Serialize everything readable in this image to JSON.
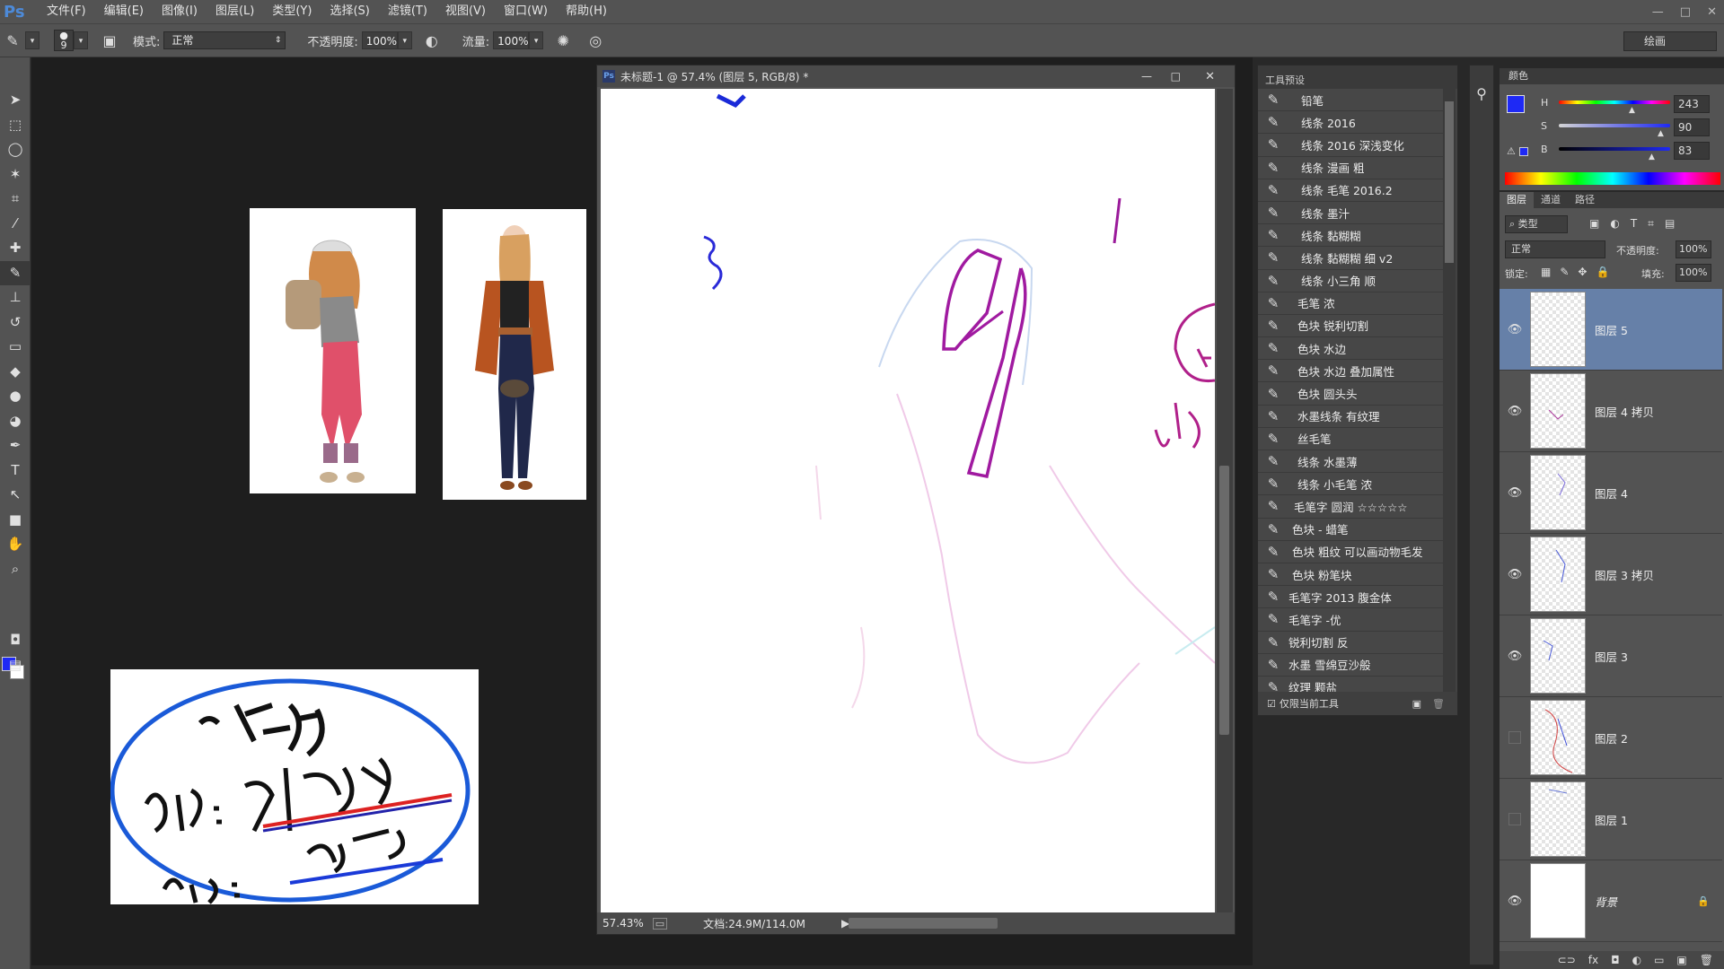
{
  "app": {
    "logo": "Ps"
  },
  "menu": [
    "文件(F)",
    "编辑(E)",
    "图像(I)",
    "图层(L)",
    "类型(Y)",
    "选择(S)",
    "滤镜(T)",
    "视图(V)",
    "窗口(W)",
    "帮助(H)"
  ],
  "window_controls": {
    "minimize": "—",
    "maximize": "□",
    "close": "✕"
  },
  "options": {
    "brush_size": "9",
    "mode_label": "模式:",
    "mode_value": "正常",
    "opacity_label": "不透明度:",
    "opacity_value": "100%",
    "flow_label": "流量:",
    "flow_value": "100%",
    "workspace": "绘画"
  },
  "document": {
    "title": "未标题-1 @ 57.4% (图层 5, RGB/8) *",
    "zoom": "57.43%",
    "doc_size": "文档:24.9M/114.0M"
  },
  "presets": {
    "tab": "工具预设",
    "items": [
      "铅笔",
      "线条 2016",
      "线条 2016 深浅变化",
      "线条 漫画 粗",
      "线条 毛笔 2016.2",
      "线条 墨汁",
      "线条 黏糊糊",
      "线条 黏糊糊 细 v2",
      "线条 小三角 顺",
      "毛笔 浓",
      "色块 锐利切割",
      "色块 水边",
      "色块 水边 叠加属性",
      "色块 圆头头",
      "水墨线条 有纹理",
      "丝毛笔",
      "线条 水墨薄",
      "线条 小毛笔 浓",
      "毛笔字 圆润 ☆☆☆☆☆",
      "色块 - 蜡笔",
      "色块 粗纹 可以画动物毛发",
      "色块 粉笔块",
      "毛笔字 2013 腹金体",
      "毛笔字 -优",
      "锐利切割 反",
      "水墨 雪绵豆沙般",
      "纹理 颗盐"
    ],
    "footer": "仅限当前工具"
  },
  "color_panel": {
    "tab": "颜色",
    "h_label": "H",
    "h_value": "243",
    "s_label": "S",
    "s_value": "90",
    "b_label": "B",
    "b_value": "83",
    "foreground": "#1e29f5",
    "background": "#ffffff"
  },
  "layers_panel": {
    "tabs": [
      "图层",
      "通道",
      "路径"
    ],
    "filter": "类型",
    "blend_mode": "正常",
    "opacity_label": "不透明度:",
    "opacity_value": "100%",
    "lock_label": "锁定:",
    "fill_label": "填充:",
    "fill_value": "100%",
    "layers": [
      {
        "name": "图层 5",
        "visible": true,
        "selected": true
      },
      {
        "name": "图层 4 拷贝",
        "visible": true,
        "selected": false
      },
      {
        "name": "图层 4",
        "visible": true,
        "selected": false
      },
      {
        "name": "图层 3 拷贝",
        "visible": true,
        "selected": false
      },
      {
        "name": "图层 3",
        "visible": true,
        "selected": false
      },
      {
        "name": "图层 2",
        "visible": false,
        "selected": false
      },
      {
        "name": "图层 1",
        "visible": false,
        "selected": false
      },
      {
        "name": "背景",
        "visible": true,
        "selected": false,
        "locked": true
      }
    ]
  }
}
